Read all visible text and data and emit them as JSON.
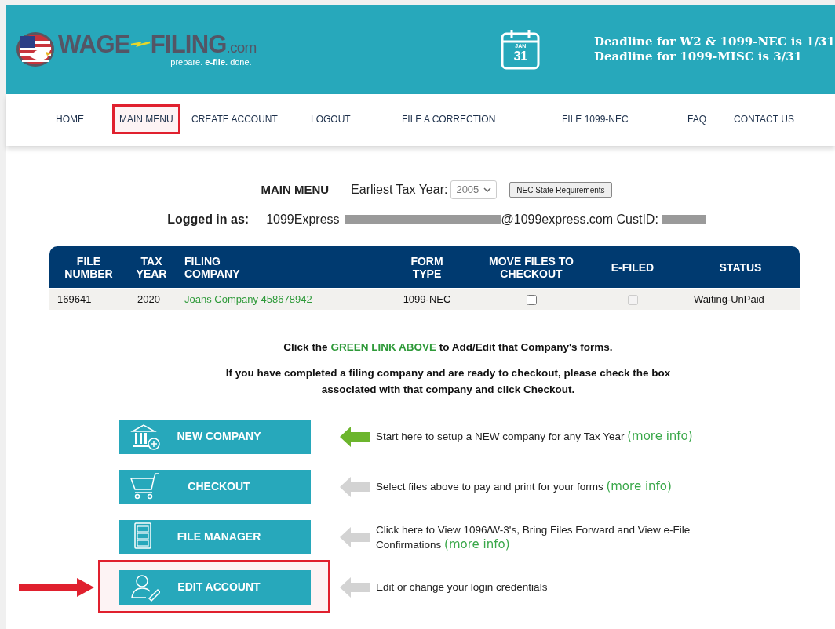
{
  "header": {
    "logo": {
      "word_1": "WAGE",
      "word_2": "FILING",
      "suffix": ".com",
      "tagline": "prepare. **e-file.** done."
    },
    "calendar": {
      "month": "JAN",
      "day": "31"
    },
    "deadlines": [
      "Deadline for W2 & 1099-NEC is 1/31",
      "Deadline for 1099-MISC is 3/31"
    ]
  },
  "nav": [
    {
      "label": "HOME",
      "highlighted": false
    },
    {
      "label": "MAIN MENU",
      "highlighted": true
    },
    {
      "label": "CREATE ACCOUNT",
      "highlighted": false
    },
    {
      "label": "LOGOUT",
      "highlighted": false
    },
    {
      "label": "FILE A CORRECTION",
      "highlighted": false
    },
    {
      "label": "FILE 1099-NEC",
      "highlighted": false
    },
    {
      "label": "FAQ",
      "highlighted": false
    },
    {
      "label": "CONTACT US",
      "highlighted": false
    }
  ],
  "toolbar": {
    "title": "MAIN MENU",
    "year_label": "Earliest Tax Year:",
    "year_value": "2005",
    "requirements_button": "NEC State Requirements"
  },
  "login": {
    "label": "Logged in as:",
    "parts": [
      {
        "kind": "text",
        "text": "1099Express"
      },
      {
        "kind": "redacted"
      },
      {
        "kind": "text",
        "text": "@1099express.com CustID:"
      },
      {
        "kind": "redacted"
      }
    ]
  },
  "table": {
    "columns": [
      "FILE NUMBER",
      "TAX YEAR",
      "FILING COMPANY",
      "FORM TYPE",
      "MOVE FILES TO CHECKOUT",
      "E-FILED",
      "STATUS"
    ],
    "rows": [
      {
        "file_number": "169641",
        "tax_year": "2020",
        "company": "Joans Company 458678942",
        "form_type": "1099-NEC",
        "move_checked": false,
        "efiled_checked": false,
        "efiled_disabled": true,
        "status": "Waiting-UnPaid"
      }
    ]
  },
  "instructions": [
    {
      "segments": [
        {
          "text": "Click the ",
          "green": false
        },
        {
          "text": "GREEN LINK ABOVE",
          "green": true
        },
        {
          "text": " to Add/Edit that Company's forms.",
          "green": false
        }
      ]
    },
    {
      "segments": [
        {
          "text": "If you have completed a filing company and are ready to checkout, please check the box associated with that company and click Checkout.",
          "green": false
        }
      ]
    }
  ],
  "actions": [
    {
      "kind": "bank",
      "label": "NEW COMPANY",
      "color": "#6cb52d",
      "description": "Start here to setup a NEW company for any Tax Year",
      "link": "(more info)",
      "highlighted": false
    },
    {
      "kind": "cart",
      "label": "CHECKOUT",
      "color": "#d3d3d3",
      "description": "Select files above to pay and print for your forms",
      "link": "(more info)",
      "highlighted": false
    },
    {
      "kind": "cabinet",
      "label": "FILE MANAGER",
      "color": "#d3d3d3",
      "description": "Click here to View 1096/W-3's, Bring Files Forward and View e-File Confirmations",
      "link": "(more info)",
      "highlighted": false
    },
    {
      "kind": "user",
      "label": "EDIT ACCOUNT",
      "color": "#d3d3d3",
      "description": "Edit or change your login credentials",
      "highlighted": true
    }
  ]
}
